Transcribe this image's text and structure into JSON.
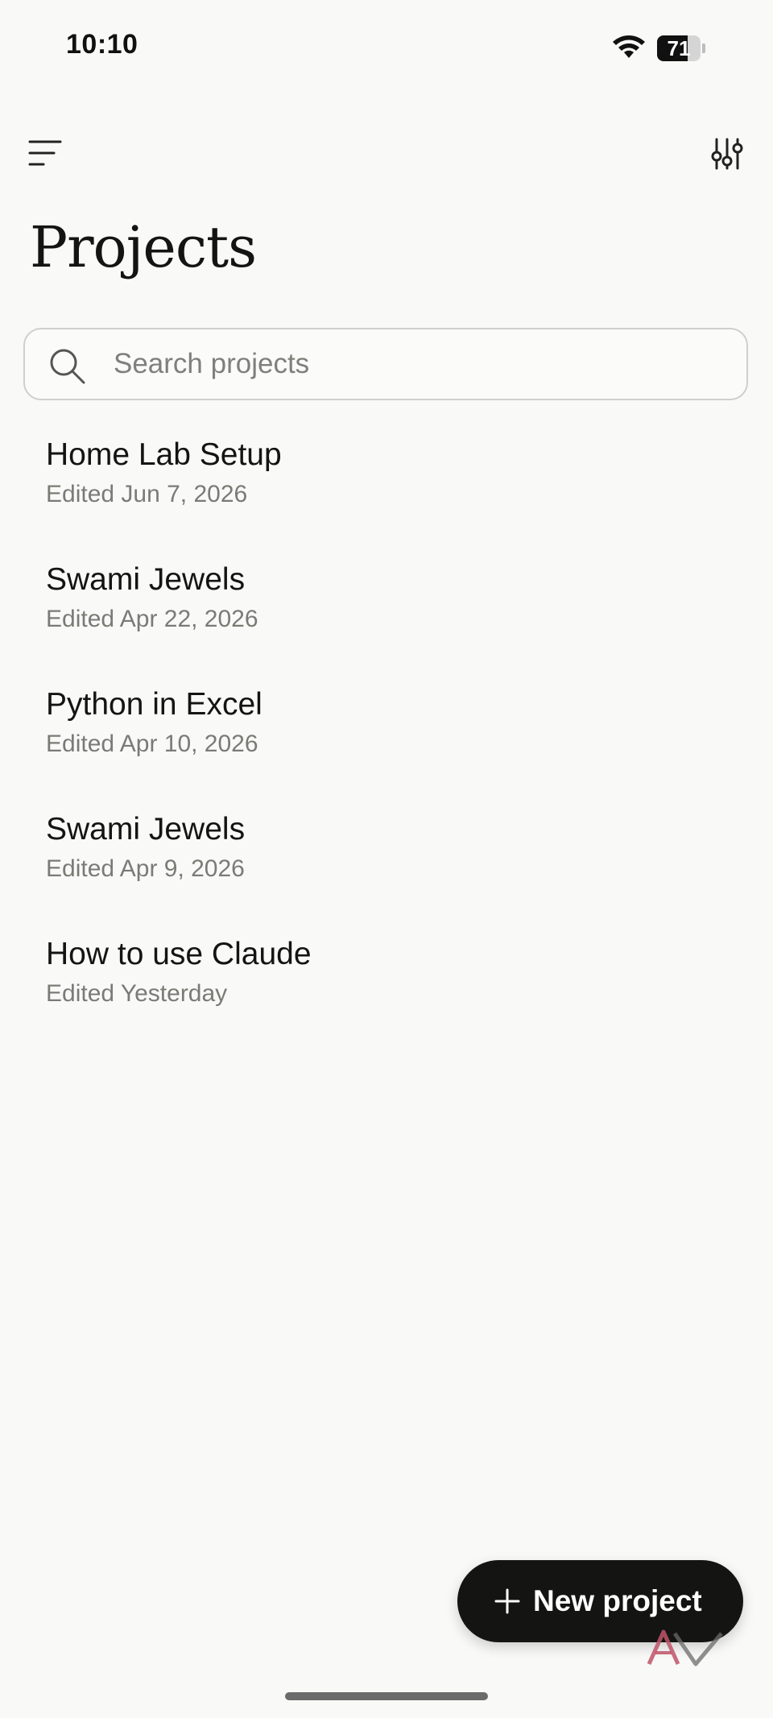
{
  "status_bar": {
    "time": "10:10",
    "battery_level": "71",
    "battery_fraction": 0.71
  },
  "header": {
    "menu_icon": "hamburger-menu-icon",
    "filter_icon": "sliders-icon",
    "title": "Projects"
  },
  "search": {
    "icon": "search-icon",
    "placeholder": "Search projects",
    "value": ""
  },
  "projects": [
    {
      "name": "Home Lab Setup",
      "edited": "Edited Jun 7, 2026"
    },
    {
      "name": "Swami Jewels",
      "edited": "Edited Apr 22, 2026"
    },
    {
      "name": "Python in Excel",
      "edited": "Edited Apr 10, 2026"
    },
    {
      "name": "Swami Jewels",
      "edited": "Edited Apr 9, 2026"
    },
    {
      "name": "How to use Claude",
      "edited": "Edited Yesterday"
    }
  ],
  "fab": {
    "icon": "plus-icon",
    "label": "New project"
  },
  "colors": {
    "background": "#f9f9f8",
    "text_primary": "#141413",
    "text_secondary": "#7b7b75",
    "fab_background": "#141413",
    "search_border": "#cfcfcb"
  }
}
